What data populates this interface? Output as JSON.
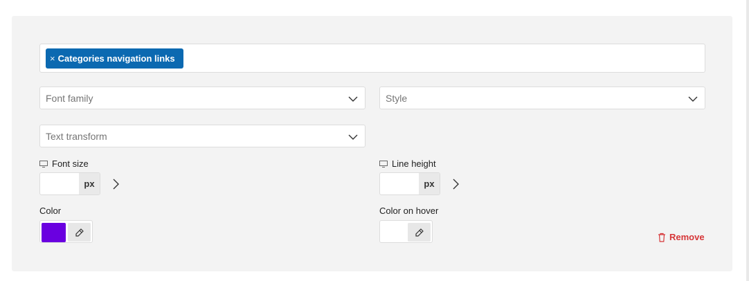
{
  "tag": {
    "close_glyph": "×",
    "label": "Categories navigation links"
  },
  "selects": {
    "font_family": "Font family",
    "style": "Style",
    "text_transform": "Text transform"
  },
  "font_size": {
    "label": "Font size",
    "value": "",
    "unit": "px"
  },
  "line_height": {
    "label": "Line height",
    "value": "",
    "unit": "px"
  },
  "color": {
    "label": "Color",
    "value": "#6a00e0"
  },
  "color_hover": {
    "label": "Color on hover",
    "value": ""
  },
  "remove": {
    "label": "Remove",
    "color": "#d63638"
  },
  "theme": {
    "tag_bg": "#0b69b1",
    "panel_bg": "#f3f3f3"
  }
}
